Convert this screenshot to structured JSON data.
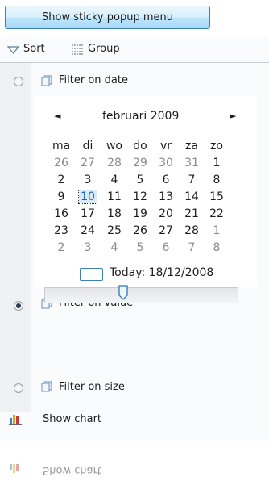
{
  "button": {
    "label": "Show sticky popup menu"
  },
  "toolbar": {
    "sort_label": "Sort",
    "group_label": "Group"
  },
  "filters": {
    "date_label": "Filter on date",
    "value_label": "Filter on value",
    "size_label": "Filter on size"
  },
  "calendar": {
    "month": "februari 2009",
    "prev": "◄",
    "next": "►",
    "day_headers": [
      "ma",
      "di",
      "wo",
      "do",
      "vr",
      "za",
      "zo"
    ],
    "weeks": [
      [
        "26",
        "27",
        "28",
        "29",
        "30",
        "31",
        "1"
      ],
      [
        "2",
        "3",
        "4",
        "5",
        "6",
        "7",
        "8"
      ],
      [
        "9",
        "10",
        "11",
        "12",
        "13",
        "14",
        "15"
      ],
      [
        "16",
        "17",
        "18",
        "19",
        "20",
        "21",
        "22"
      ],
      [
        "23",
        "24",
        "25",
        "26",
        "27",
        "28",
        "1"
      ],
      [
        "2",
        "3",
        "4",
        "5",
        "6",
        "7",
        "8"
      ]
    ],
    "selected": "10",
    "today_label": "Today: 18/12/2008"
  },
  "slider": {
    "value_fraction": 0.4
  },
  "chart": {
    "label": "Show chart"
  },
  "icons": {
    "sort": "triangle-down-icon",
    "group": "group-icon",
    "filter": "filter-icon",
    "chart": "bar-chart-icon"
  },
  "colors": {
    "accent": "#3c7fb1",
    "selected": "#1a5fb4"
  }
}
